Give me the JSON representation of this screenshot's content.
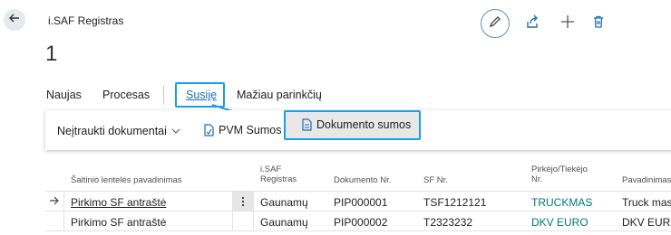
{
  "header": {
    "title": "i.SAF Registras",
    "record_no": "1"
  },
  "icons": {
    "back": "arrow-left-icon",
    "edit": "pencil-icon",
    "share": "share-icon",
    "add": "plus-icon",
    "delete": "trash-icon"
  },
  "menu": {
    "items": [
      "Naujas",
      "Procesas",
      "Susiję",
      "Mažiau parinkčių"
    ],
    "active": "Susiję"
  },
  "submenu": {
    "dropdown_label": "Neįtraukti dokumentai",
    "pvm_label": "PVM Sumos",
    "doc_sums_label": "Dokumento sumos"
  },
  "table": {
    "columns": [
      "Šaltinio lentelės pavadinimas",
      "i.SAF Registras",
      "Dokumento Nr.",
      "SF Nr.",
      "Pirkėjo/Tiekėjo Nr.",
      "Pavadinimas"
    ],
    "col_registras_line1": "i.SAF",
    "col_registras_line2": "Registras",
    "col_pirkejo_line1": "Pirkėjo/Tiekėjo",
    "col_pirkejo_line2": "Nr.",
    "col_pavad_visible": "Pavadinimas",
    "rows": [
      {
        "source": "Pirkimo SF antraštė",
        "registras": "Gaunamų",
        "doc_no": "PIP000001",
        "sf_no": "TSF1212121",
        "partner_no": "TRUCKMAS",
        "name": "Truck mas"
      },
      {
        "source": "Pirkimo SF antraštė",
        "registras": "Gaunamų",
        "doc_no": "PIP000002",
        "sf_no": "T2323232",
        "partner_no": "DKV EURO",
        "name": "DKV EURO"
      }
    ]
  },
  "colors": {
    "highlight": "#1b9ee6",
    "link_teal": "#00787a",
    "active_menu": "#1f6fb2"
  }
}
